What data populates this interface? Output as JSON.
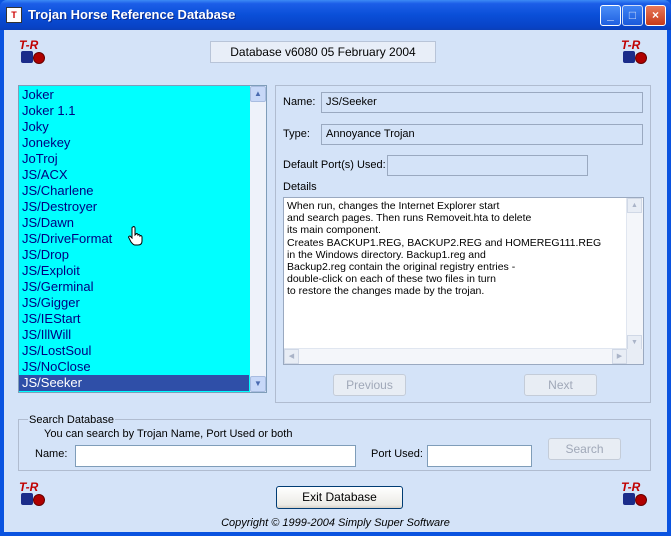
{
  "window": {
    "title": "Trojan Horse Reference Database",
    "minimize": "_",
    "maximize": "□",
    "close": "×"
  },
  "header": {
    "database_version": "Database v6080 05 February 2004",
    "logo_text": "T-R"
  },
  "trojan_list": {
    "items": [
      "Joker",
      "Joker 1.1",
      "Joky",
      "Jonekey",
      "JoTroj",
      "JS/ACX",
      "JS/Charlene",
      "JS/Destroyer",
      "JS/Dawn",
      "JS/DriveFormat",
      "JS/Drop",
      "JS/Exploit",
      "JS/Germinal",
      "JS/Gigger",
      "JS/IEStart",
      "JS/IllWill",
      "JS/LostSoul",
      "JS/NoClose",
      "JS/Seeker"
    ],
    "selected": "JS/Seeker"
  },
  "detail": {
    "name_label": "Name:",
    "name_value": "JS/Seeker",
    "type_label": "Type:",
    "type_value": "Annoyance Trojan",
    "ports_label": "Default Port(s) Used:",
    "ports_value": "",
    "details_label": "Details",
    "details_text": "When run, changes the Internet Explorer start\nand search pages. Then runs Removeit.hta to delete\nits main component.\nCreates BACKUP1.REG, BACKUP2.REG and HOMEREG111.REG\nin the Windows directory. Backup1.reg and\nBackup2.reg contain the original registry entries -\ndouble-click on each of these two files in turn\nto restore the changes made by the trojan.",
    "previous_label": "Previous",
    "next_label": "Next"
  },
  "search": {
    "group_title": "Search Database",
    "hint": "You can search by Trojan Name, Port Used or both",
    "name_label": "Name:",
    "name_value": "",
    "port_label": "Port Used:",
    "port_value": "",
    "search_label": "Search"
  },
  "footer": {
    "exit_label": "Exit Database",
    "copyright": "Copyright © 1999-2004 Simply Super Software"
  },
  "colors": {
    "list_background": "#00ffff",
    "selection": "#2f4fa8",
    "client": "#d4e3f8",
    "titlebar": "#0a4fd8"
  }
}
